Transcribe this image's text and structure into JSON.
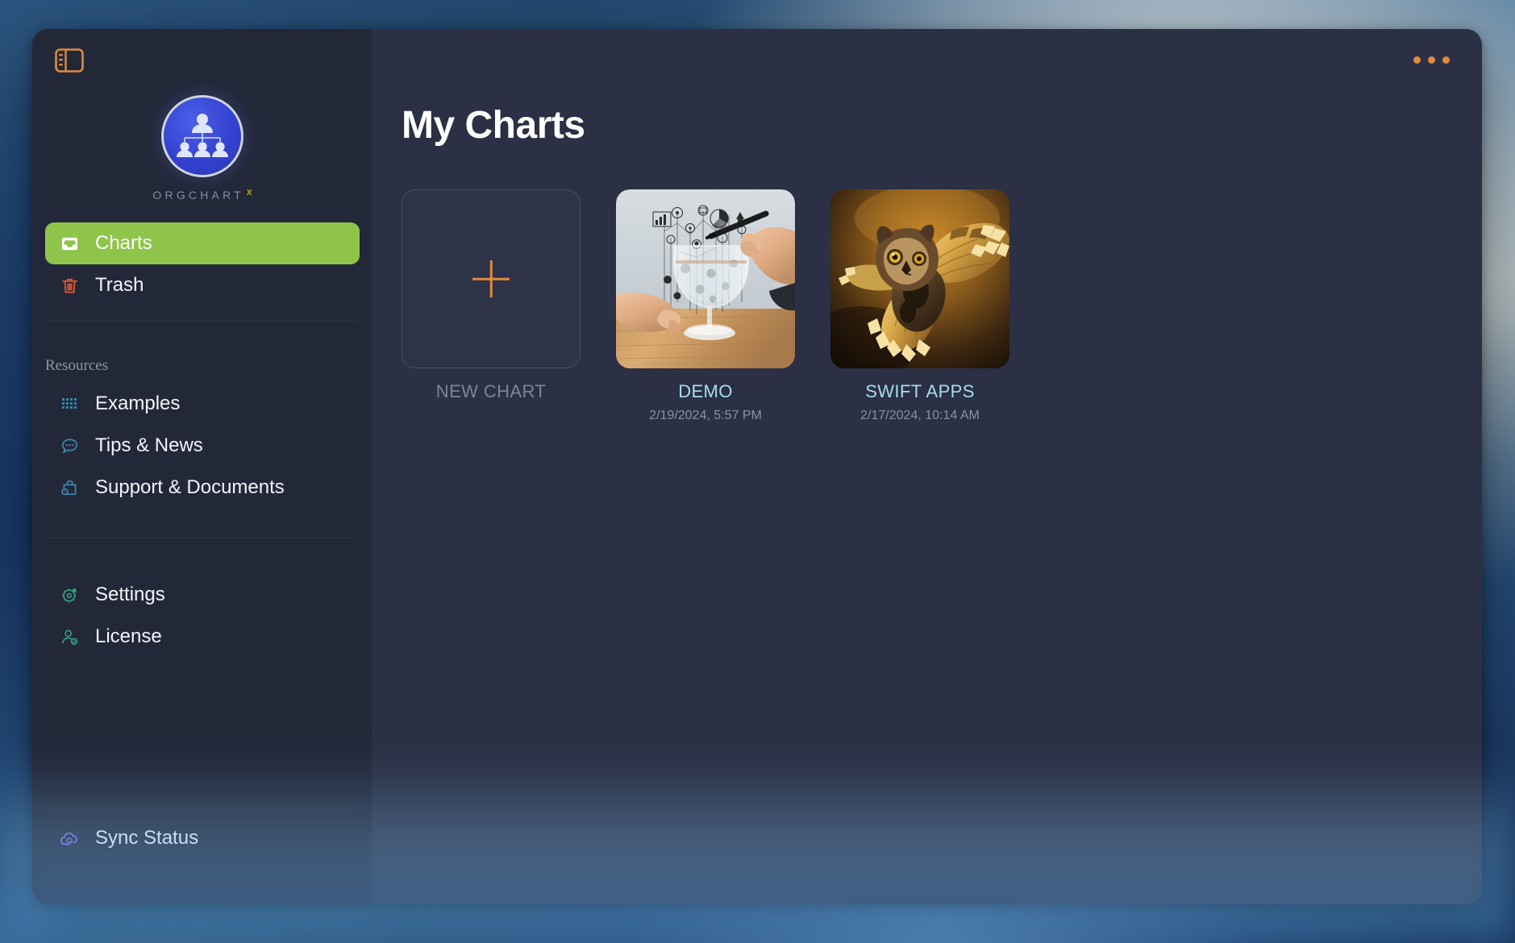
{
  "window": {
    "sidebar_toggle_icon": "sidebar-panel-icon",
    "more_options_icon": "ellipsis-icon"
  },
  "brand": {
    "logo_icon": "org-chart-logo-icon",
    "wordmark": "ORGCHART",
    "wordmark_superscript": "X"
  },
  "sidebar": {
    "primary": [
      {
        "label": "Charts",
        "icon": "inbox-tray-icon",
        "active": true
      },
      {
        "label": "Trash",
        "icon": "trash-can-icon",
        "active": false
      }
    ],
    "resources_title": "Resources",
    "resources": [
      {
        "label": "Examples",
        "icon": "grid-dots-icon"
      },
      {
        "label": "Tips & News",
        "icon": "chat-bubble-icon"
      },
      {
        "label": "Support & Documents",
        "icon": "briefcase-help-icon"
      }
    ],
    "settings_group": [
      {
        "label": "Settings",
        "icon": "gear-icon"
      },
      {
        "label": "License",
        "icon": "user-check-icon"
      }
    ],
    "footer": [
      {
        "label": "Sync Status",
        "icon": "cloud-sync-icon"
      }
    ]
  },
  "main": {
    "title": "My Charts",
    "cards": [
      {
        "title": "NEW CHART",
        "date": "",
        "kind": "new",
        "icon": "plus-icon"
      },
      {
        "title": "DEMO",
        "date": "2/19/2024, 5:57 PM",
        "kind": "thumbnail",
        "thumbnail": "hands-drawing-org-chart-over-wine-glass"
      },
      {
        "title": "SWIFT APPS",
        "date": "2/17/2024, 10:14 AM",
        "kind": "thumbnail",
        "thumbnail": "flying-owl-golden-background"
      }
    ]
  },
  "colors": {
    "accent_green": "#8fc44b",
    "accent_orange": "#e08a3c",
    "link_blue": "#a8dcee",
    "sidebar_bg": "#232839",
    "content_bg": "#2b3044",
    "trash_red": "#e0522d",
    "icon_blue": "#3f86a8",
    "icon_green": "#35a07e",
    "icon_purple": "#7a6fd6",
    "logo_blue": "#3442d0"
  }
}
